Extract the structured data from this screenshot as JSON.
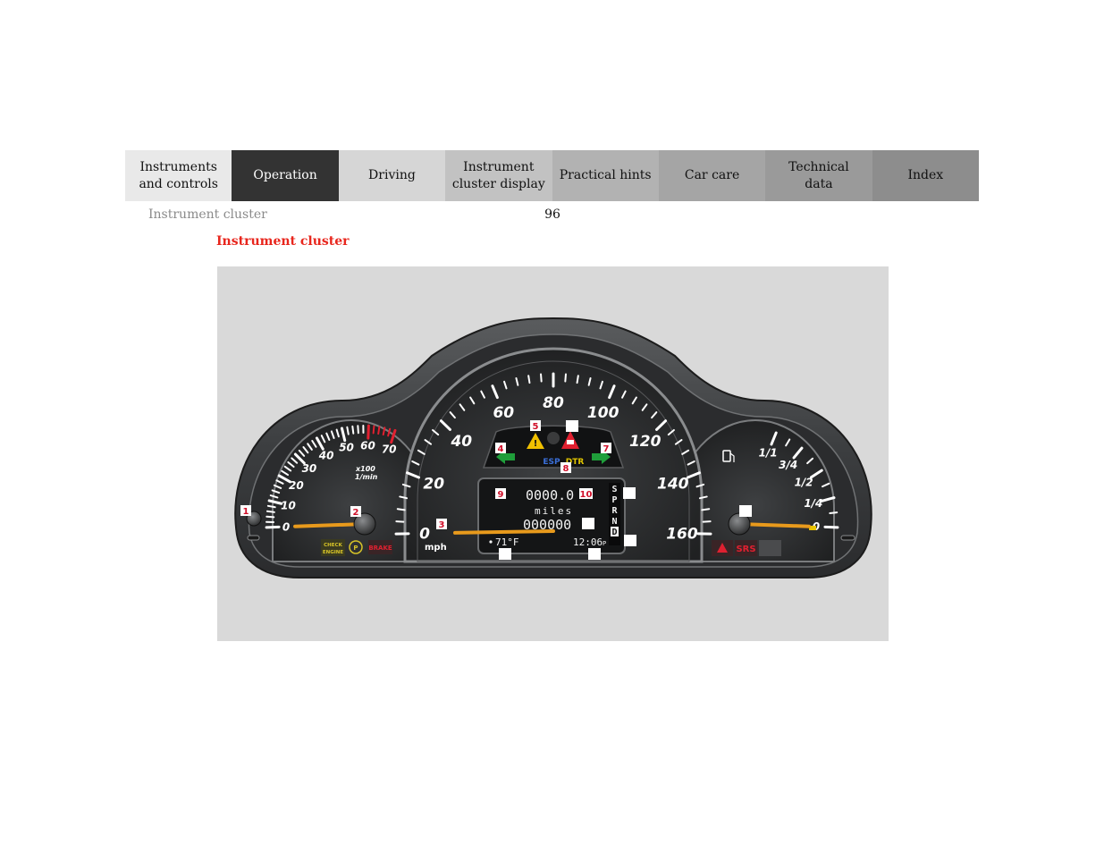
{
  "nav": {
    "tabs": [
      {
        "label": "Instruments\nand controls"
      },
      {
        "label": "Operation",
        "active": true
      },
      {
        "label": "Driving"
      },
      {
        "label": "Instrument\ncluster display"
      },
      {
        "label": "Practical hints"
      },
      {
        "label": "Car care"
      },
      {
        "label": "Technical\ndata"
      },
      {
        "label": "Index"
      }
    ]
  },
  "header": {
    "section": "Instrument cluster",
    "page_number": "96"
  },
  "content": {
    "heading": "Instrument cluster"
  },
  "figure": {
    "tachometer": {
      "labels": [
        "0",
        "10",
        "20",
        "30",
        "40",
        "50",
        "60",
        "70"
      ],
      "unit_line1": "x100",
      "unit_line2": "1/min",
      "check_engine_line1": "CHECK",
      "check_engine_line2": "ENGINE",
      "brake": "BRAKE",
      "reading": 0
    },
    "speedometer": {
      "labels": [
        "0",
        "20",
        "40",
        "60",
        "80",
        "100",
        "120",
        "140",
        "160"
      ],
      "unit": "mph",
      "reading": 0
    },
    "fuel_gauge": {
      "labels": [
        "0",
        "1/4",
        "1/2",
        "3/4",
        "1/1"
      ],
      "srs": "SRS",
      "level": 0
    },
    "display": {
      "trip_odometer": "0000.0",
      "unit": "miles",
      "odometer": "000000",
      "temperature": "71°F",
      "clock": "12:06",
      "clock_suffix": "P",
      "gears": [
        "S",
        "P",
        "R",
        "N",
        "D"
      ],
      "selected_gear": "D",
      "esp": "ESP",
      "dtr": "DTR"
    },
    "callouts": [
      "1",
      "2",
      "3",
      "4",
      "5",
      "",
      "7",
      "8",
      "9",
      "10",
      "",
      "",
      "",
      "",
      "",
      ""
    ],
    "colors": {
      "needle": "#e89a1c",
      "warning_red": "#e02030",
      "warning_yellow": "#f0c000",
      "turn_green": "#1f9e3a",
      "esp_blue": "#3a6fd8",
      "dtr_yellow": "#e0c400"
    }
  }
}
